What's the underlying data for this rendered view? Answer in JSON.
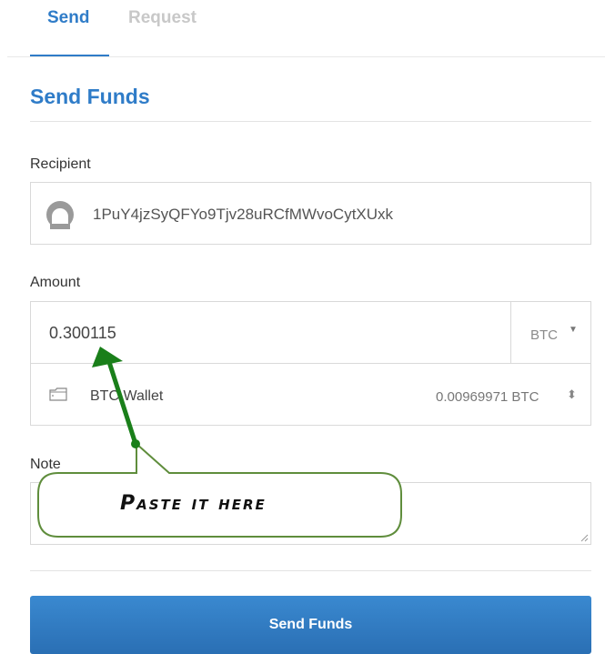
{
  "tabs": [
    {
      "label": "Send"
    },
    {
      "label": "Request"
    }
  ],
  "form": {
    "title": "Send Funds",
    "recipient_label": "Recipient",
    "recipient_value": "1PuY4jzSyQFYo9Tjv28uRCfMWvoCytXUxk",
    "amount_label": "Amount",
    "amount_value": "0.300115",
    "currency": "BTC",
    "wallet_name": "BTC Wallet",
    "wallet_balance": "0.00969971 BTC",
    "note_label": "Note",
    "note_value": "",
    "submit_label": "Send Funds"
  },
  "annotation": {
    "callout_text": "Paste it here",
    "color": "#1a7f1a"
  },
  "colors": {
    "accent": "#2f7cc8",
    "inactive_tab": "#c8c8c8",
    "button": "#2f7cc8"
  }
}
